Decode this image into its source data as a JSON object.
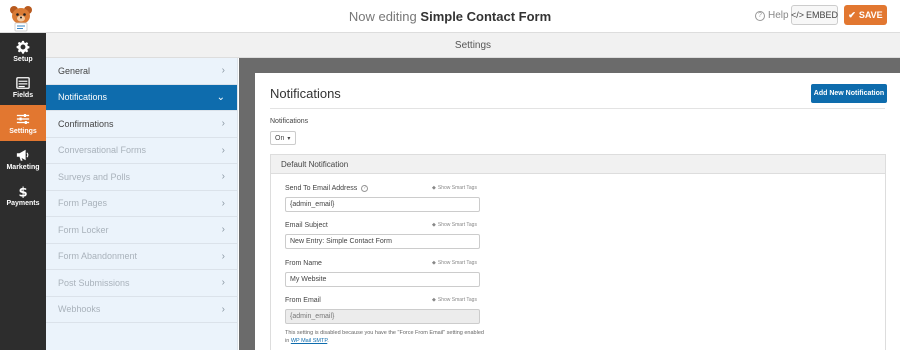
{
  "header": {
    "title_prefix": "Now editing",
    "form_name": "Simple Contact Form",
    "help_label": "Help",
    "embed_label": "EMBED",
    "save_label": "SAVE"
  },
  "leftbar": [
    {
      "label": "Setup",
      "icon": "gear-icon",
      "active": false
    },
    {
      "label": "Fields",
      "icon": "list-icon",
      "active": false
    },
    {
      "label": "Settings",
      "icon": "sliders-icon",
      "active": true
    },
    {
      "label": "Marketing",
      "icon": "megaphone-icon",
      "active": false
    },
    {
      "label": "Payments",
      "icon": "dollar-icon",
      "active": false
    }
  ],
  "settings_header": "Settings",
  "panel_nav": [
    {
      "label": "General",
      "state": "normal"
    },
    {
      "label": "Notifications",
      "state": "active"
    },
    {
      "label": "Confirmations",
      "state": "normal"
    },
    {
      "label": "Conversational Forms",
      "state": "disabled"
    },
    {
      "label": "Surveys and Polls",
      "state": "disabled"
    },
    {
      "label": "Form Pages",
      "state": "disabled"
    },
    {
      "label": "Form Locker",
      "state": "disabled"
    },
    {
      "label": "Form Abandonment",
      "state": "disabled"
    },
    {
      "label": "Post Submissions",
      "state": "disabled"
    },
    {
      "label": "Webhooks",
      "state": "disabled"
    }
  ],
  "content": {
    "title": "Notifications",
    "add_button": "Add New Notification",
    "notifications_label": "Notifications",
    "notifications_value": "On",
    "default_notification": "Default Notification",
    "smart_tags_label": "Show Smart Tags",
    "fields": [
      {
        "label": "Send To Email Address",
        "value": "{admin_email}",
        "help": true,
        "disabled": false
      },
      {
        "label": "Email Subject",
        "value": "New Entry: Simple Contact Form",
        "help": false,
        "disabled": false
      },
      {
        "label": "From Name",
        "value": "My Website",
        "help": false,
        "disabled": false
      },
      {
        "label": "From Email",
        "value": "{admin_email}",
        "help": false,
        "disabled": true
      }
    ],
    "note_text": "This setting is disabled because you have the \"Force From Email\" setting enabled in",
    "note_link": "WP Mail SMTP",
    "note_end": "."
  },
  "colors": {
    "accent_orange": "#e27730",
    "accent_blue": "#0e6cad",
    "sidebar_dark": "#2d2d2d"
  }
}
